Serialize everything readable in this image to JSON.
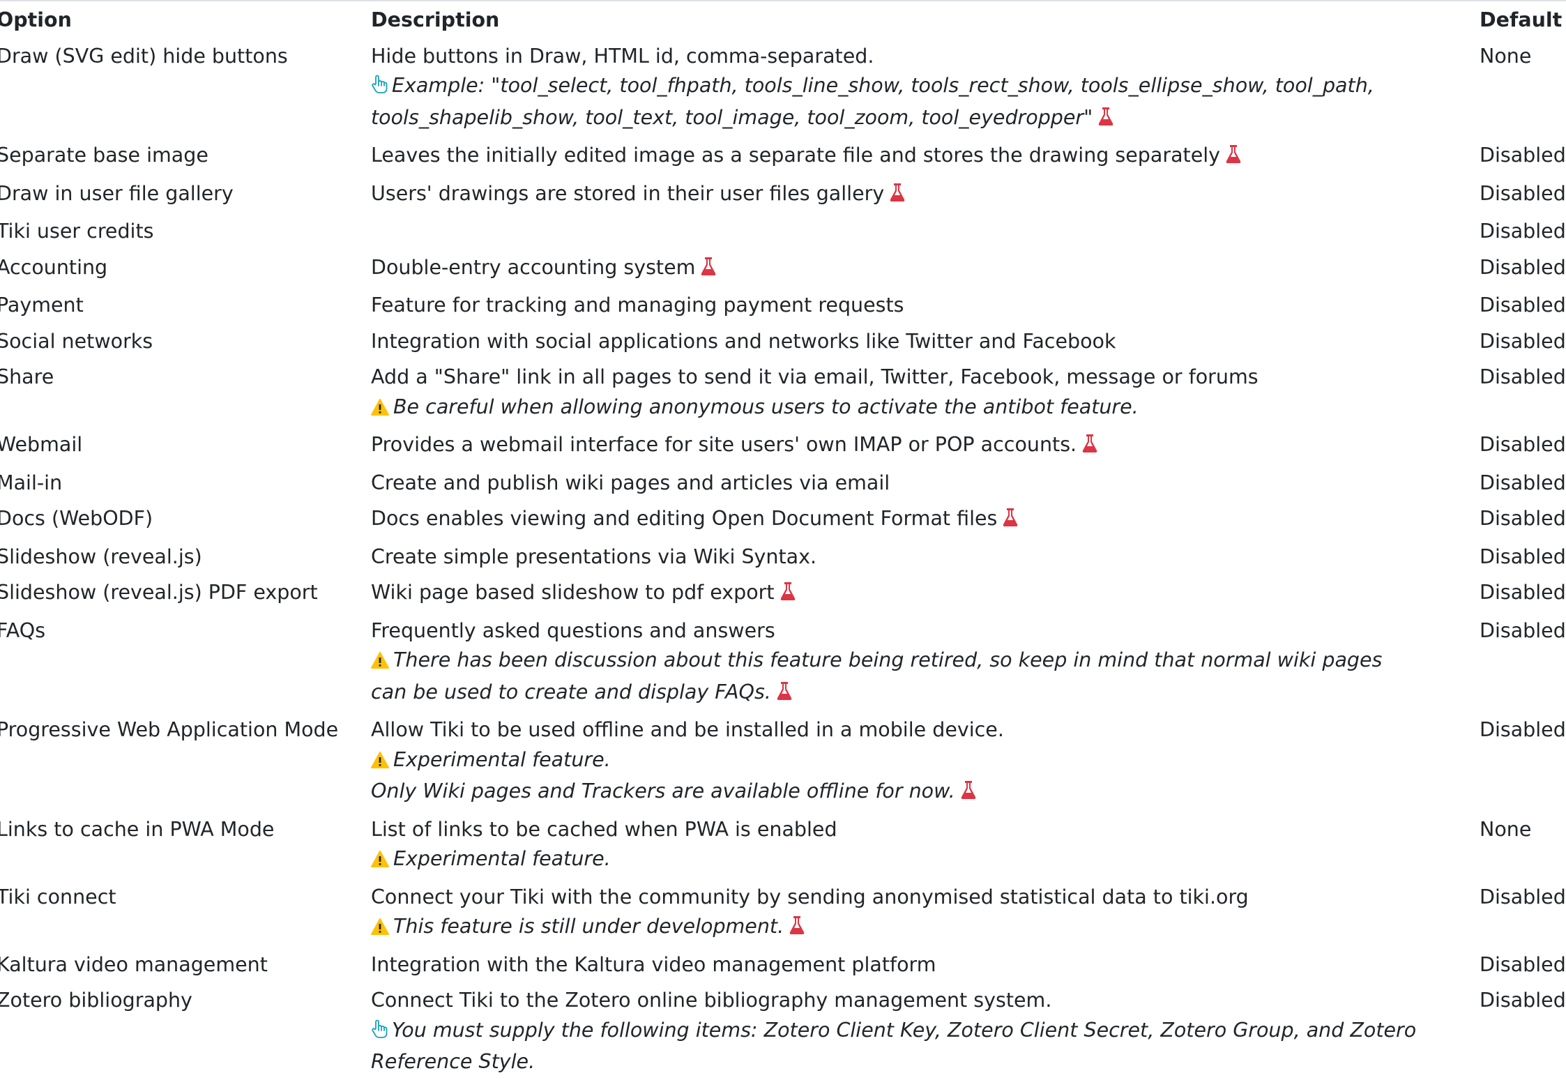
{
  "headers": {
    "option": "Option",
    "description": "Description",
    "default": "Default"
  },
  "colors": {
    "text": "#212529",
    "experimental_flask": "#dc3545",
    "warning": "#ffc107",
    "tip": "#17a2b8"
  },
  "rows": [
    {
      "option": "Draw (SVG edit) hide buttons",
      "description": "Hide buttons in Draw, HTML id, comma-separated.",
      "notes": [
        {
          "icon": "pointing-hand-icon",
          "lines": [
            "Example: \"tool_select, tool_fhpath, tools_line_show, tools_rect_show, tools_ellipse_show, tool_path,",
            "tools_shapelib_show, tool_text, tool_image, tool_zoom, tool_eyedropper\""
          ],
          "flask": true
        }
      ],
      "flask": false,
      "default": "None"
    },
    {
      "option": "Separate base image",
      "description": "Leaves the initially edited image as a separate file and stores the drawing separately",
      "notes": [],
      "flask": true,
      "default": "Disabled"
    },
    {
      "option": "Draw in user file gallery",
      "description": "Users' drawings are stored in their user files gallery",
      "notes": [],
      "flask": true,
      "default": "Disabled"
    },
    {
      "option": "Tiki user credits",
      "description": "",
      "notes": [],
      "flask": false,
      "default": "Disabled"
    },
    {
      "option": "Accounting",
      "description": "Double-entry accounting system",
      "notes": [],
      "flask": true,
      "default": "Disabled"
    },
    {
      "option": "Payment",
      "description": "Feature for tracking and managing payment requests",
      "notes": [],
      "flask": false,
      "default": "Disabled"
    },
    {
      "option": "Social networks",
      "description": "Integration with social applications and networks like Twitter and Facebook",
      "notes": [],
      "flask": false,
      "default": "Disabled"
    },
    {
      "option": "Share",
      "description": "Add a \"Share\" link in all pages to send it via email, Twitter, Facebook, message or forums",
      "notes": [
        {
          "icon": "warning-icon",
          "lines": [
            "Be careful when allowing anonymous users to activate the antibot feature."
          ],
          "flask": false
        }
      ],
      "flask": false,
      "default": "Disabled"
    },
    {
      "option": "Webmail",
      "description": "Provides a webmail interface for site users' own IMAP or POP accounts.",
      "notes": [],
      "flask": true,
      "default": "Disabled"
    },
    {
      "option": "Mail-in",
      "description": "Create and publish wiki pages and articles via email",
      "notes": [],
      "flask": false,
      "default": "Disabled"
    },
    {
      "option": "Docs (WebODF)",
      "description": "Docs enables viewing and editing Open Document Format files",
      "notes": [],
      "flask": true,
      "default": "Disabled"
    },
    {
      "option": "Slideshow (reveal.js)",
      "description": "Create simple presentations via Wiki Syntax.",
      "notes": [],
      "flask": false,
      "default": "Disabled"
    },
    {
      "option": "Slideshow (reveal.js) PDF export",
      "description": "Wiki page based slideshow to pdf export",
      "notes": [],
      "flask": true,
      "default": "Disabled"
    },
    {
      "option": "FAQs",
      "description": "Frequently asked questions and answers",
      "notes": [
        {
          "icon": "warning-icon",
          "lines": [
            "There has been discussion about this feature being retired, so keep in mind that normal wiki pages",
            "can be used to create and display FAQs."
          ],
          "flask": true
        }
      ],
      "flask": false,
      "default": "Disabled"
    },
    {
      "option": "Progressive Web Application Mode",
      "description": "Allow Tiki to be used offline and be installed in a mobile device.",
      "notes": [
        {
          "icon": "warning-icon",
          "lines": [
            "Experimental feature."
          ],
          "flask": false
        },
        {
          "icon": "",
          "lines": [
            "Only Wiki pages and Trackers are available offline for now."
          ],
          "flask": true
        }
      ],
      "flask": false,
      "default": "Disabled"
    },
    {
      "option": "Links to cache in PWA Mode",
      "description": "List of links to be cached when PWA is enabled",
      "notes": [
        {
          "icon": "warning-icon",
          "lines": [
            "Experimental feature."
          ],
          "flask": false
        }
      ],
      "flask": false,
      "default": "None"
    },
    {
      "option": "Tiki connect",
      "description": "Connect your Tiki with the community by sending anonymised statistical data to tiki.org",
      "notes": [
        {
          "icon": "warning-icon",
          "lines": [
            "This feature is still under development."
          ],
          "flask": true
        }
      ],
      "flask": false,
      "default": "Disabled"
    },
    {
      "option": "Kaltura video management",
      "description": "Integration with the Kaltura video management platform",
      "notes": [],
      "flask": false,
      "default": "Disabled"
    },
    {
      "option": "Zotero bibliography",
      "description": "Connect Tiki to the Zotero online bibliography management system.",
      "notes": [
        {
          "icon": "pointing-hand-icon",
          "lines": [
            "You must supply the following items: Zotero Client Key, Zotero Client Secret, Zotero Group, and Zotero",
            "Reference Style."
          ],
          "flask": false
        }
      ],
      "flask": false,
      "default": "Disabled"
    }
  ]
}
